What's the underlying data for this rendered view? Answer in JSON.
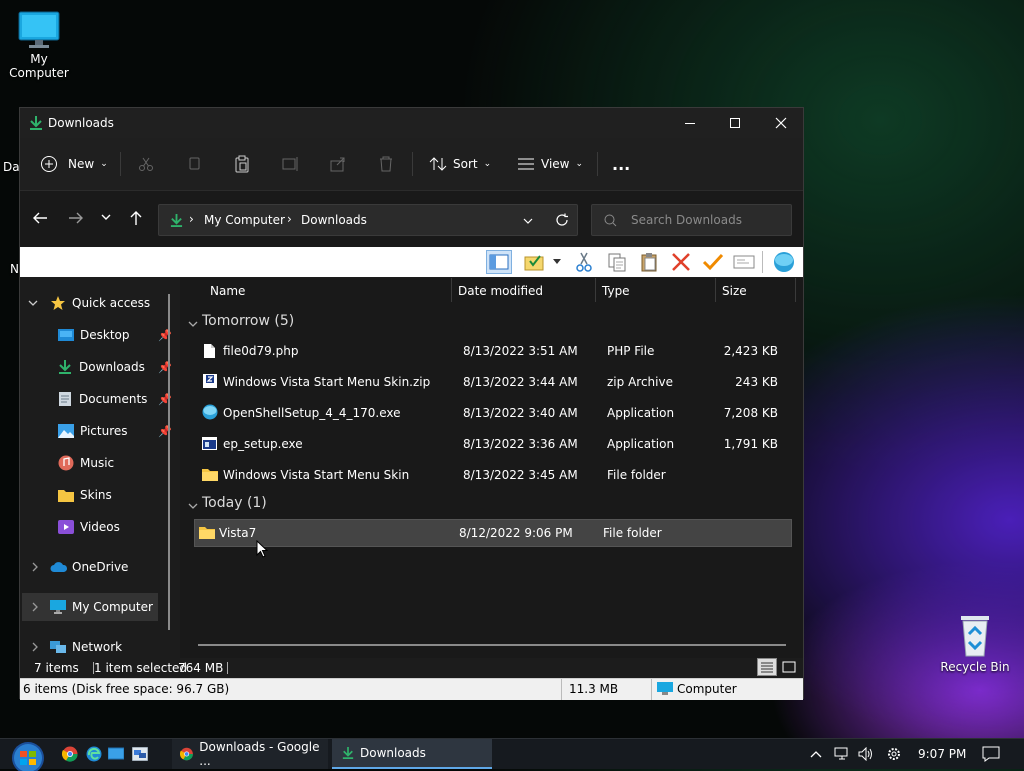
{
  "desktop": {
    "my_computer_label": "My Computer",
    "recycle_bin_label": "Recycle Bin",
    "partial_label_1": "Dat",
    "partial_label_2": "N"
  },
  "window": {
    "title": "Downloads",
    "toolbar": {
      "new_label": "New",
      "sort_label": "Sort",
      "view_label": "View",
      "more_label": "..."
    },
    "address": {
      "crumbs": [
        "My Computer",
        "Downloads"
      ]
    },
    "search": {
      "placeholder": "Search Downloads"
    },
    "nav": {
      "quick_access": "Quick access",
      "items": [
        "Desktop",
        "Downloads",
        "Documents",
        "Pictures",
        "Music",
        "Skins",
        "Videos"
      ],
      "onedrive": "OneDrive",
      "my_computer": "My Computer",
      "network": "Network"
    },
    "columns": {
      "name": "Name",
      "date": "Date modified",
      "type": "Type",
      "size": "Size"
    },
    "groups": [
      {
        "title": "Tomorrow (5)",
        "files": [
          {
            "name": "file0d79.php",
            "date": "8/13/2022 3:51 AM",
            "type": "PHP File",
            "size": "2,423 KB"
          },
          {
            "name": "Windows Vista Start Menu Skin.zip",
            "date": "8/13/2022 3:44 AM",
            "type": "zip Archive",
            "size": "243 KB"
          },
          {
            "name": "OpenShellSetup_4_4_170.exe",
            "date": "8/13/2022 3:40 AM",
            "type": "Application",
            "size": "7,208 KB"
          },
          {
            "name": "ep_setup.exe",
            "date": "8/13/2022 3:36 AM",
            "type": "Application",
            "size": "1,791 KB"
          },
          {
            "name": "Windows Vista Start Menu Skin",
            "date": "8/13/2022 3:45 AM",
            "type": "File folder",
            "size": ""
          }
        ]
      },
      {
        "title": "Today (1)",
        "files": [
          {
            "name": "Vista7",
            "date": "8/12/2022 9:06 PM",
            "type": "File folder",
            "size": ""
          }
        ]
      }
    ],
    "status": {
      "items": "7 items",
      "selected": "1 item selected",
      "size": "764 MB"
    },
    "bottom": {
      "summary": "6 items (Disk free space: 96.7 GB)",
      "total": "11.3 MB",
      "location": "Computer"
    }
  },
  "taskbar": {
    "tasks": [
      "Downloads - Google ...",
      "Downloads"
    ],
    "clock": "9:07 PM"
  },
  "colors": {
    "accent_folder": "#f5c542",
    "selection": "#444444",
    "download_green": "#2fb36b"
  }
}
